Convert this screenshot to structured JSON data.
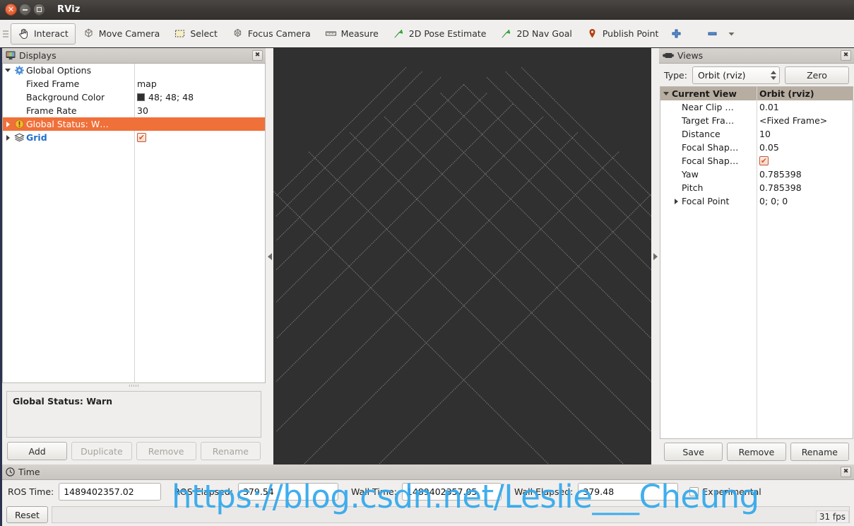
{
  "window": {
    "title": "RViz",
    "buttons": {
      "close": "×",
      "minimize": "minimize",
      "maximize": "maximize"
    }
  },
  "toolbar": {
    "items": [
      {
        "label": "Interact",
        "icon": "hand-cursor-icon",
        "active": true
      },
      {
        "label": "Move Camera",
        "icon": "move-camera-icon",
        "active": false
      },
      {
        "label": "Select",
        "icon": "select-rectangle-icon",
        "active": false
      },
      {
        "label": "Focus Camera",
        "icon": "focus-camera-icon",
        "active": false
      },
      {
        "label": "Measure",
        "icon": "ruler-icon",
        "active": false
      },
      {
        "label": "2D Pose Estimate",
        "icon": "green-arrow-icon",
        "active": false
      },
      {
        "label": "2D Nav Goal",
        "icon": "green-arrow-icon",
        "active": false
      },
      {
        "label": "Publish Point",
        "icon": "map-pin-icon",
        "active": false
      }
    ],
    "add_tool_icon": "plus-icon",
    "remove_tool_icon": "minus-icon",
    "overflow_icon": "chevron-down-icon"
  },
  "displays": {
    "title": "Displays",
    "panel_icon": "monitor-icon",
    "close_label": "✖",
    "rows": [
      {
        "name": "Global Options",
        "value": "",
        "arrow": "down",
        "icon": "gear-icon",
        "indent": 0,
        "selected": false,
        "bold": false
      },
      {
        "name": "Fixed Frame",
        "value": "map",
        "arrow": "",
        "icon": "",
        "indent": 1,
        "selected": false,
        "bold": false
      },
      {
        "name": "Background Color",
        "value": "48; 48; 48",
        "arrow": "",
        "icon": "",
        "indent": 1,
        "selected": false,
        "bold": false,
        "swatch": "#303030"
      },
      {
        "name": "Frame Rate",
        "value": "30",
        "arrow": "",
        "icon": "",
        "indent": 1,
        "selected": false,
        "bold": false
      },
      {
        "name": "Global Status: W…",
        "value": "",
        "arrow": "right",
        "icon": "warning-icon",
        "indent": 0,
        "selected": true,
        "bold": false
      },
      {
        "name": "Grid",
        "value": "",
        "arrow": "right",
        "icon": "grid-layers-icon",
        "indent": 0,
        "selected": false,
        "bold": true,
        "checkbox": true
      }
    ],
    "status_text": "Global Status: Warn",
    "buttons": [
      {
        "label": "Add",
        "enabled": true
      },
      {
        "label": "Duplicate",
        "enabled": false
      },
      {
        "label": "Remove",
        "enabled": false
      },
      {
        "label": "Rename",
        "enabled": false
      }
    ]
  },
  "viewport": {
    "background_color": "#303030",
    "grid_color": "#9a9a9a",
    "collapse_left_icon": "triangle-left-icon",
    "collapse_right_icon": "triangle-right-icon"
  },
  "views": {
    "title": "Views",
    "panel_icon": "camera-icon",
    "close_label": "✖",
    "type_label": "Type:",
    "type_value": "Orbit (rviz)",
    "zero_label": "Zero",
    "header": {
      "name": "Current View",
      "value": "Orbit (rviz)"
    },
    "rows": [
      {
        "name": "Near Clip …",
        "value": "0.01"
      },
      {
        "name": "Target Fra…",
        "value": "<Fixed Frame>"
      },
      {
        "name": "Distance",
        "value": "10"
      },
      {
        "name": "Focal Shap…",
        "value": "0.05"
      },
      {
        "name": "Focal Shap…",
        "value": "",
        "checkbox": true
      },
      {
        "name": "Yaw",
        "value": "0.785398"
      },
      {
        "name": "Pitch",
        "value": "0.785398"
      },
      {
        "name": "Focal Point",
        "value": "0; 0; 0",
        "arrow": "right"
      }
    ],
    "buttons": [
      {
        "label": "Save",
        "enabled": true
      },
      {
        "label": "Remove",
        "enabled": true
      },
      {
        "label": "Rename",
        "enabled": true
      }
    ]
  },
  "time": {
    "title": "Time",
    "panel_icon": "clock-icon",
    "close_label": "✖",
    "fields": [
      {
        "label": "ROS Time:",
        "value": "1489402357.02"
      },
      {
        "label": "ROS Elapsed:",
        "value": "379.54"
      },
      {
        "label": "Wall Time:",
        "value": "1489402357.05"
      },
      {
        "label": "Wall Elapsed:",
        "value": "379.48"
      }
    ],
    "experimental_label": "Experimental",
    "experimental_checked": false,
    "reset_label": "Reset",
    "statusbar_text": "",
    "fps": "31 fps"
  },
  "watermark": {
    "text": "https://blog.csdn.net/Leslie___Cheung",
    "color": "#31a8ec"
  }
}
